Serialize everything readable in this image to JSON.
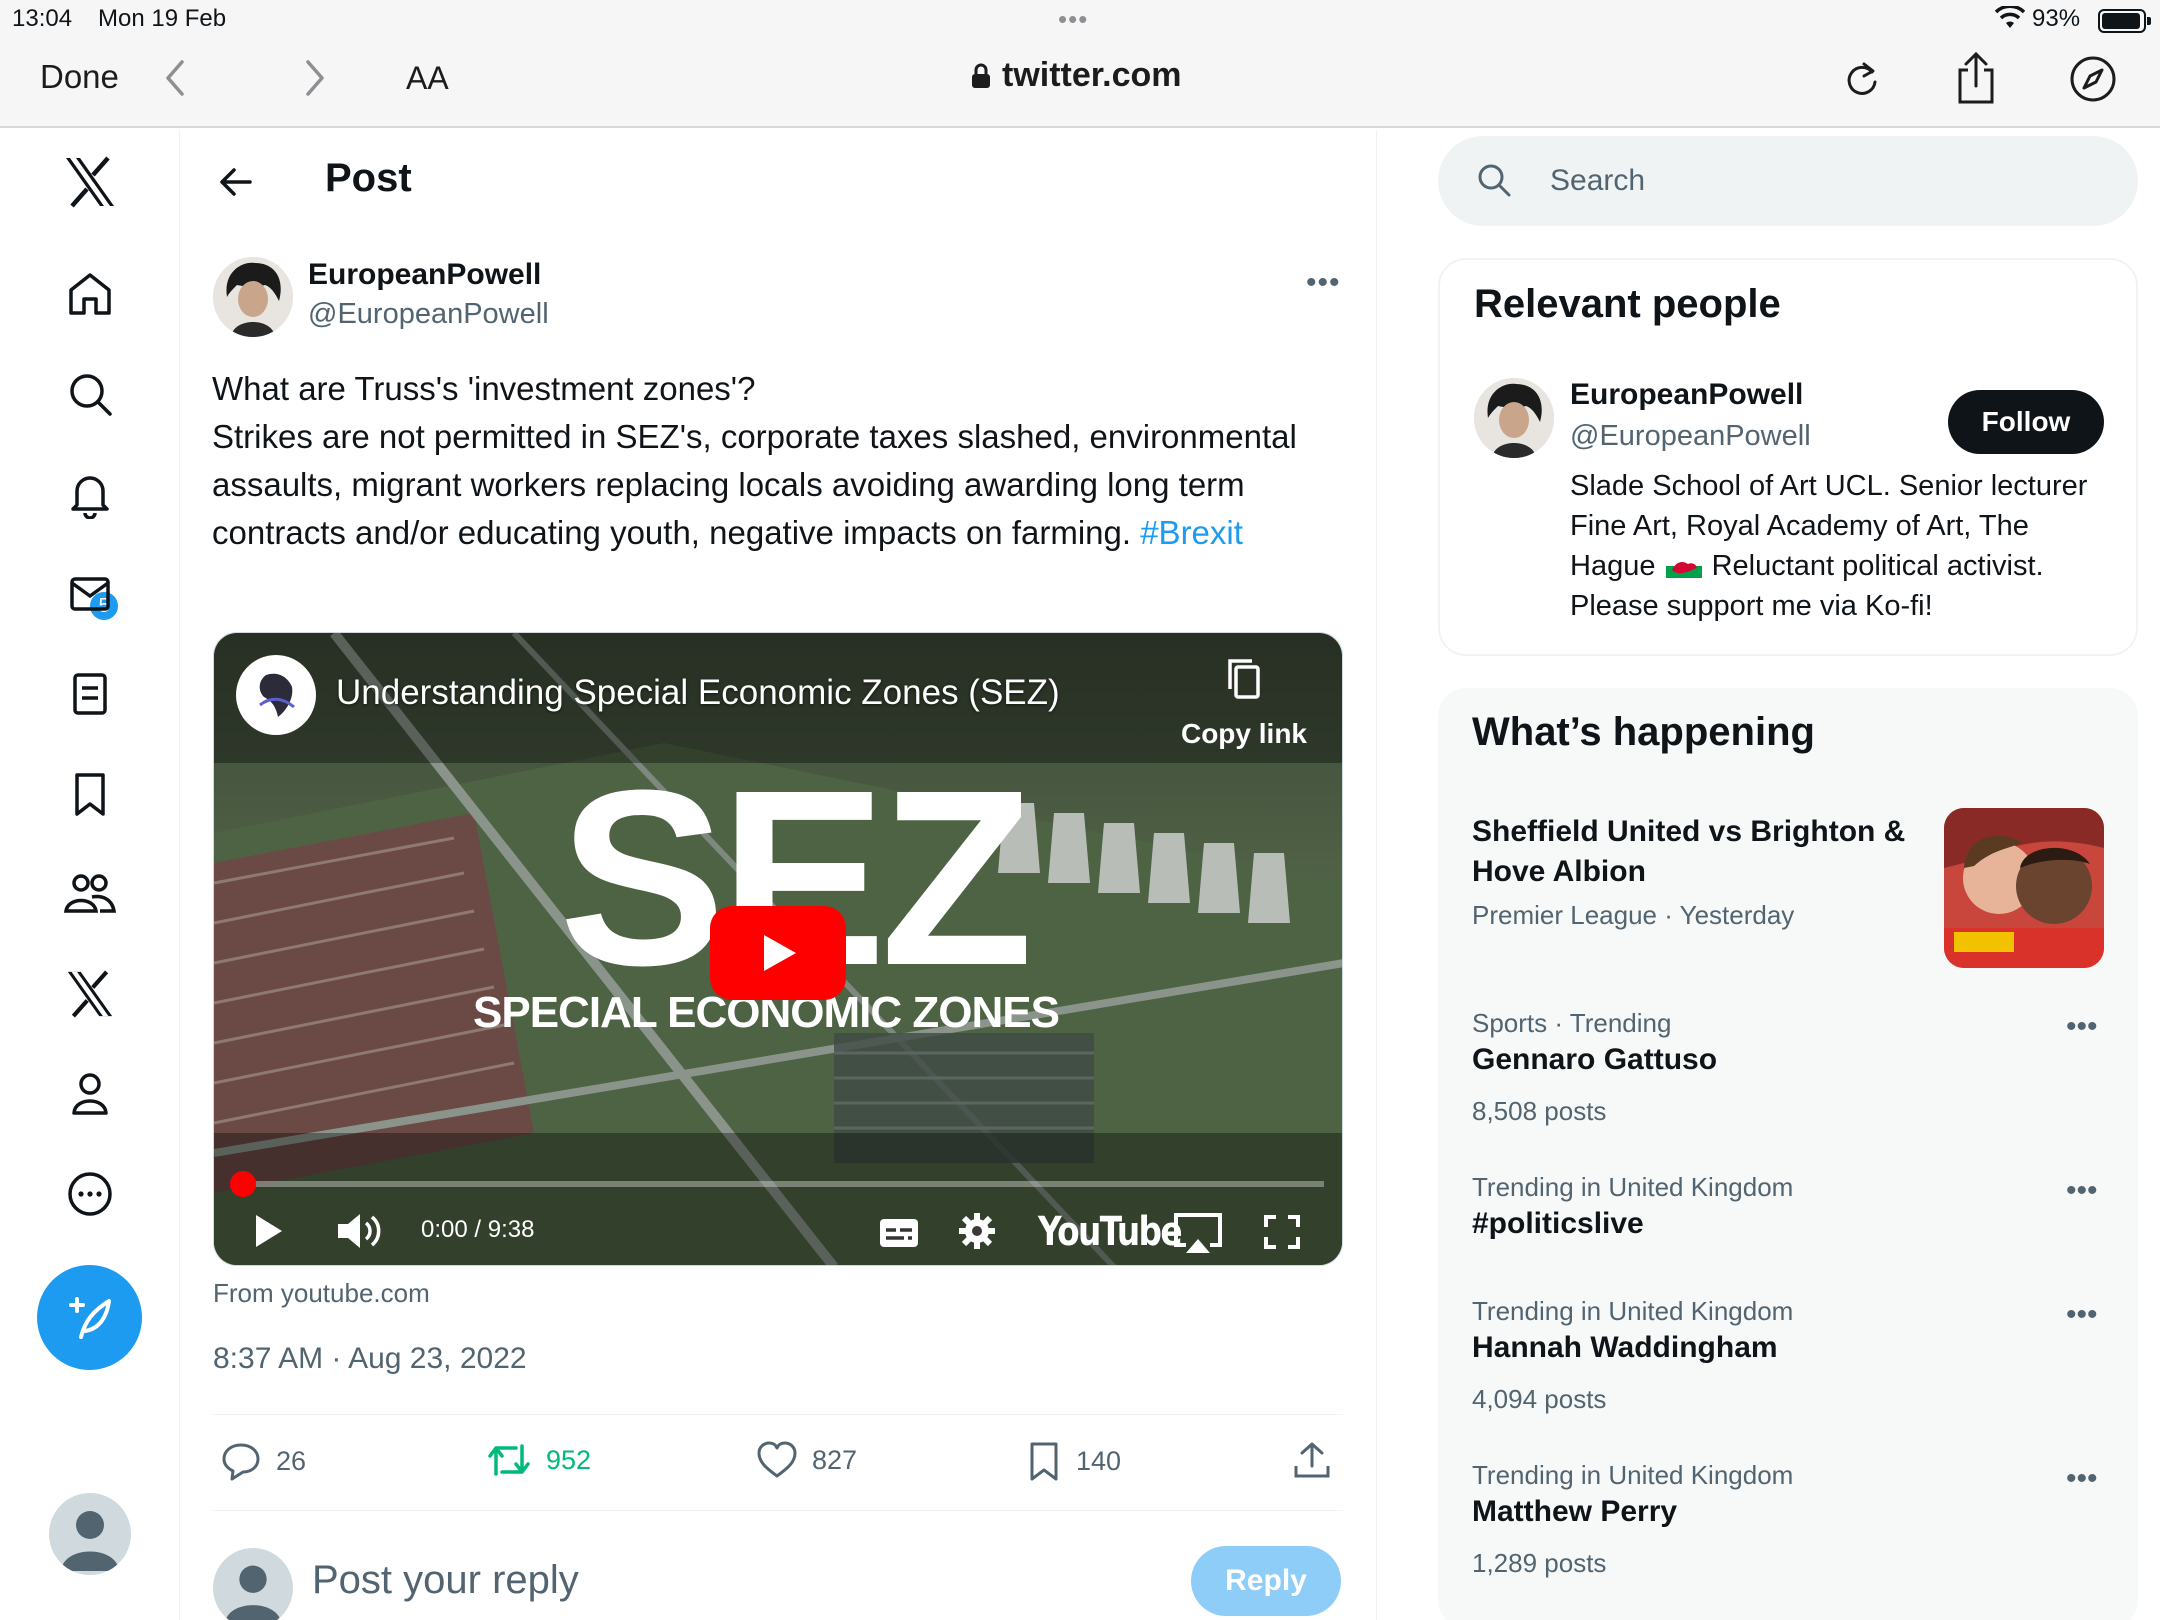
{
  "status_bar": {
    "time": "13:04",
    "date": "Mon 19 Feb",
    "battery": "93%"
  },
  "browser": {
    "done_label": "Done",
    "text_size": "AA",
    "url": "twitter.com"
  },
  "left_nav": {
    "notification_badge": "5",
    "items": [
      "x-logo",
      "home-icon",
      "explore-icon",
      "notifications-icon",
      "messages-icon",
      "lists-icon",
      "bookmarks-icon",
      "communities-icon",
      "premium-icon",
      "profile-icon",
      "more-icon"
    ]
  },
  "post": {
    "page_title": "Post",
    "author_name": "EuropeanPowell",
    "author_handle": "@EuropeanPowell",
    "text": "What are Truss's 'investment zones'?\nStrikes are not permitted in SEZ's, corporate taxes slashed, environmental assaults, migrant workers replacing locals avoiding awarding long term contracts and/or educating youth, negative impacts on farming. ",
    "hashtag": "#Brexit",
    "video": {
      "title": "Understanding Special Economic Zones (SEZ)",
      "copy_link": "Copy link",
      "big_text": "SEZ",
      "sub_text": "SPECIAL ECONOMIC ZONES",
      "time": "0:00 / 9:38",
      "brand": "YouTube",
      "progress": 0.01
    },
    "source": "From youtube.com",
    "timestamp": "8:37 AM · Aug 23, 2022",
    "stats": {
      "replies": "26",
      "retweets": "952",
      "likes": "827",
      "bookmarks": "140"
    },
    "reply_placeholder": "Post your reply",
    "reply_button": "Reply"
  },
  "sidebar": {
    "search_placeholder": "Search",
    "relevant_people": {
      "title": "Relevant people",
      "name": "EuropeanPowell",
      "handle": "@EuropeanPowell",
      "bio_part1": "Slade School of Art UCL. Senior lecturer Fine Art, Royal Academy of Art, The Hague",
      "bio_part2": " Reluctant political activist. Please support me via Ko-fi!",
      "follow_label": "Follow"
    },
    "whats_happening": {
      "title": "What’s happening",
      "featured": {
        "name": "Sheffield United vs Brighton & Hove Albion",
        "meta": "Premier League · Yesterday"
      },
      "trends": [
        {
          "category": "Sports · Trending",
          "name": "Gennaro Gattuso",
          "count": "8,508 posts"
        },
        {
          "category": "Trending in United Kingdom",
          "name": "#politicslive",
          "count": ""
        },
        {
          "category": "Trending in United Kingdom",
          "name": "Hannah Waddingham",
          "count": "4,094 posts"
        },
        {
          "category": "Trending in United Kingdom",
          "name": "Matthew Perry",
          "count": "1,289 posts"
        }
      ]
    }
  },
  "colors": {
    "accent": "#1d9bf0",
    "retweet": "#00ba7c",
    "youtube_red": "#ff0000",
    "text": "#0f1419",
    "secondary": "#536471"
  }
}
